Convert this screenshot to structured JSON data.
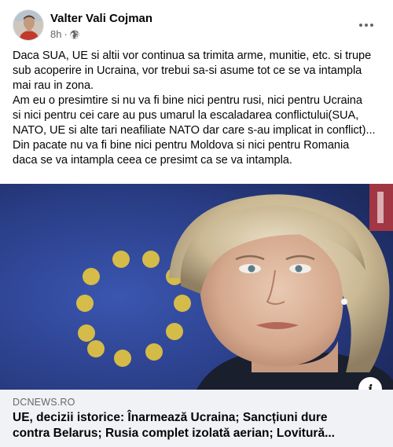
{
  "post": {
    "author": "Valter Vali Cojman",
    "time": "8h",
    "time_separator": "·",
    "privacy_icon": "globe-icon",
    "menu_icon": "more-options-icon",
    "text_lines": [
      "Daca SUA, UE si altii vor continua sa trimita arme, munitie, etc. si trupe",
      "sub acoperire in Ucraina, vor trebui sa-si asume tot ce se va intampla",
      "mai rau in zona.",
      "Am eu o presimtire si nu va fi bine nici pentru rusi, nici pentru Ucraina",
      "si nici pentru cei care au pus umarul la escaladarea conflictului(SUA,",
      "NATO, UE si alte tari neafiliate NATO dar care s-au implicat in conflict)...",
      "Din pacate nu va fi bine nici pentru Moldova si nici pentru Romania",
      "daca se va intampla ceea ce presimt ca se va intampla."
    ]
  },
  "link_preview": {
    "domain": "DCNEWS.RO",
    "headline_lines": [
      "UE, decizii istorice: Înarmează Ucraina; Sancțiuni dure",
      "contra Belarus; Rusia complet izolată aerian; Lovitură..."
    ],
    "info_icon": "info-icon",
    "info_glyph": "i"
  },
  "colors": {
    "eu_blue": "#2c3f86",
    "eu_star": "#f2cf3a",
    "footer_bg": "#f0f2f5",
    "secondary_text": "#65676b"
  }
}
